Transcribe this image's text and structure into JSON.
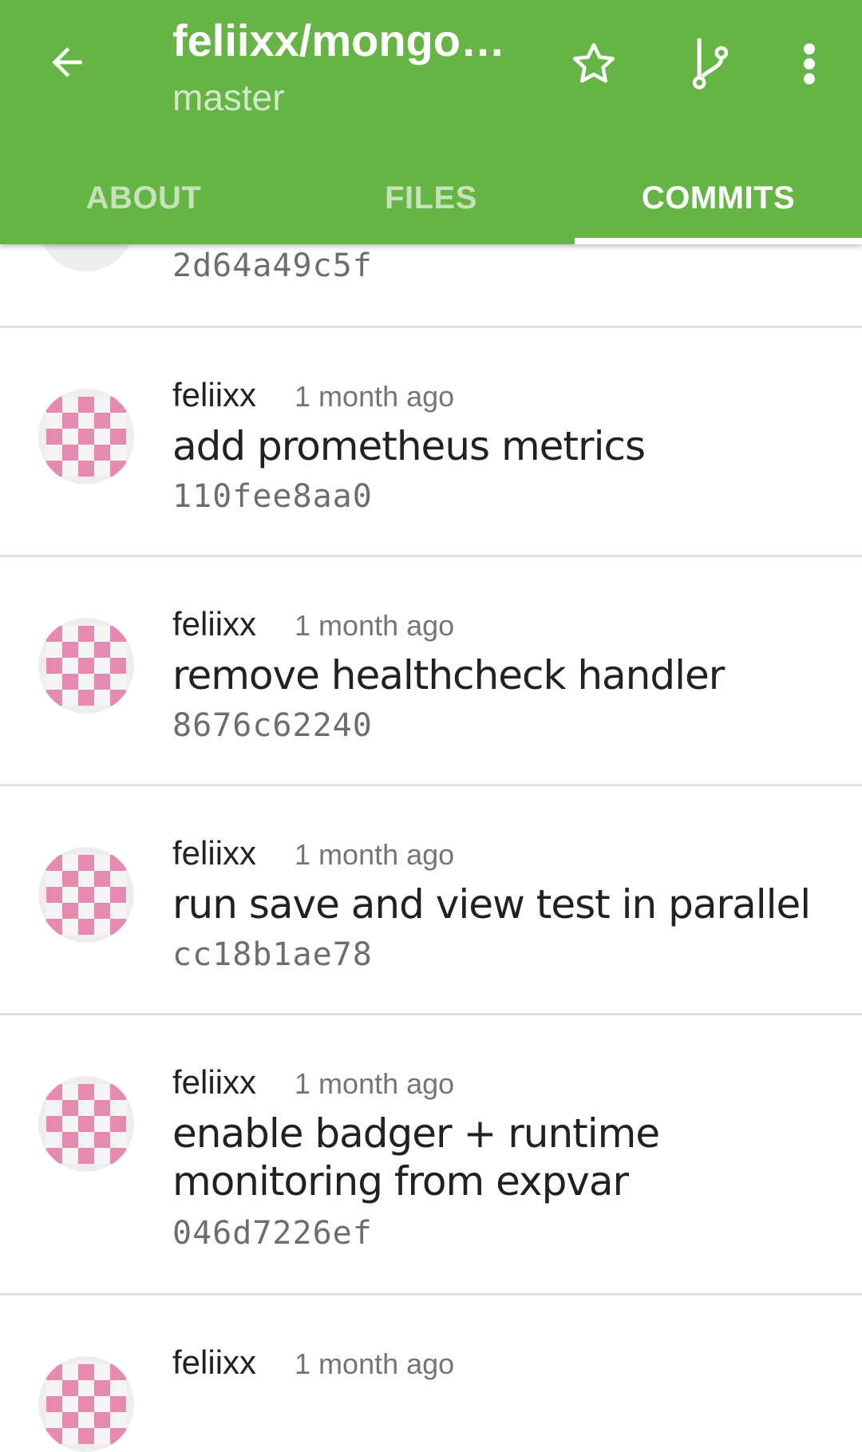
{
  "appbar": {
    "title": "feliixx/mongo…",
    "branch": "master",
    "icons": {
      "back": "arrow-back-icon",
      "star": "star-outline-icon",
      "branch": "git-branch-icon",
      "more": "more-vert-icon"
    },
    "background": "#66b446"
  },
  "tabs": [
    {
      "label": "ABOUT",
      "active": false
    },
    {
      "label": "FILES",
      "active": false
    },
    {
      "label": "COMMITS",
      "active": true
    }
  ],
  "commits": [
    {
      "author": "",
      "time": "",
      "message": "",
      "sha": "2d64a49c5f"
    },
    {
      "author": "feliixx",
      "time": "1 month ago",
      "message": "add prometheus metrics",
      "sha": "110fee8aa0"
    },
    {
      "author": "feliixx",
      "time": "1 month ago",
      "message": "remove healthcheck handler",
      "sha": "8676c62240"
    },
    {
      "author": "feliixx",
      "time": "1 month ago",
      "message": "run save and view test in parallel",
      "sha": "cc18b1ae78"
    },
    {
      "author": "feliixx",
      "time": "1 month ago",
      "message": "enable badger + runtime monitoring from expvar",
      "sha": "046d7226ef"
    },
    {
      "author": "feliixx",
      "time": "1 month ago",
      "message": "",
      "sha": ""
    }
  ],
  "avatar_colors": {
    "pink": "#e58bb2",
    "light": "#f4f4f4"
  }
}
